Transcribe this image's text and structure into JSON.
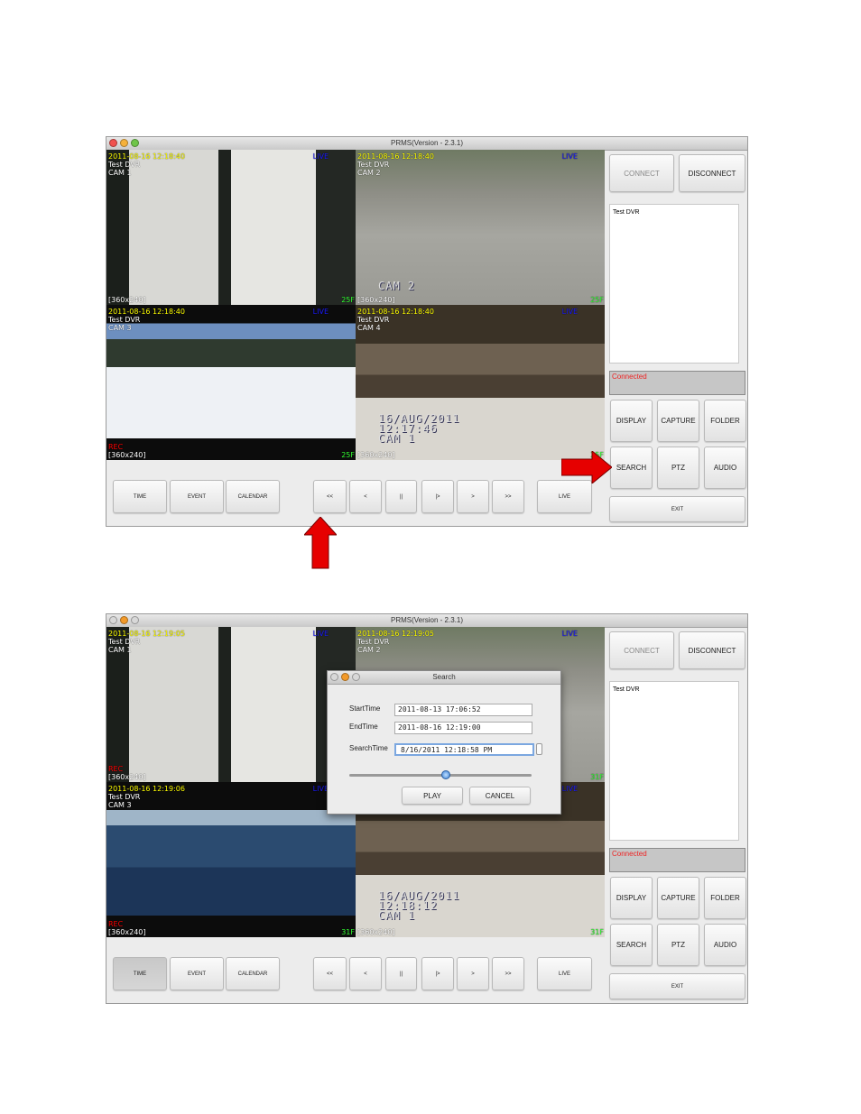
{
  "windows": [
    {
      "title": "PRMS(Version - 2.3.1)",
      "tiles": [
        {
          "timestamp": "2011-08-16 12:18:40",
          "dvr": "Test DVR",
          "cam": "CAM 1",
          "live": "LIVE",
          "rec": "",
          "resolution": "[360x240]",
          "fps": "25F",
          "scene": "door"
        },
        {
          "timestamp": "2011-08-16 12:18:40",
          "dvr": "Test DVR",
          "cam": "CAM 2",
          "live": "LIVE",
          "rec": "",
          "resolution": "[360x240]",
          "fps": "25F",
          "scene": "parking",
          "burned": "CAM 2"
        },
        {
          "timestamp": "2011-08-16 12:18:40",
          "dvr": "Test DVR",
          "cam": "CAM 3",
          "live": "LIVE",
          "rec": "REC",
          "resolution": "[360x240]",
          "fps": "25F",
          "scene": "snow"
        },
        {
          "timestamp": "2011-08-16 12:18:40",
          "dvr": "Test DVR",
          "cam": "CAM 4",
          "live": "LIVE",
          "rec": "",
          "resolution": "[360x240]",
          "fps": "25F",
          "scene": "warehouse",
          "burned": "16/AUG/2011\n12:17:46\nCAM 1"
        }
      ],
      "connect": "CONNECT",
      "disconnect": "DISCONNECT",
      "dvr_list": [
        "Test DVR"
      ],
      "status": "Connected",
      "panel_buttons": [
        "DISPLAY",
        "CAPTURE",
        "FOLDER",
        "SEARCH",
        "PTZ",
        "AUDIO"
      ],
      "exit": "EXIT",
      "bottom_buttons": [
        "TIME",
        "EVENT",
        "CALENDAR",
        "<<",
        "<",
        "||",
        "|>",
        ">",
        ">>",
        "LIVE"
      ],
      "pressed": ""
    },
    {
      "title": "PRMS(Version - 2.3.1)",
      "tiles": [
        {
          "timestamp": "2011-08-16 12:19:05",
          "dvr": "Test DVR",
          "cam": "CAM 1",
          "live": "LIVE",
          "rec": "REC",
          "resolution": "[360x240]",
          "fps": "",
          "scene": "door"
        },
        {
          "timestamp": "2011-08-16 12:19:05",
          "dvr": "Test DVR",
          "cam": "CAM 2",
          "live": "LIVE",
          "rec": "",
          "resolution": "",
          "fps": "31F",
          "scene": "parking"
        },
        {
          "timestamp": "2011-08-16 12:19:06",
          "dvr": "Test DVR",
          "cam": "CAM 3",
          "live": "LIVE",
          "rec": "REC",
          "resolution": "[360x240]",
          "fps": "31F",
          "scene": "wave"
        },
        {
          "timestamp": "",
          "dvr": "",
          "cam": "",
          "live": "LIVE",
          "rec": "",
          "resolution": "[360x240]",
          "fps": "31F",
          "scene": "warehouse",
          "burned": "16/AUG/2011\n12:18:12\nCAM 1"
        }
      ],
      "connect": "CONNECT",
      "disconnect": "DISCONNECT",
      "dvr_list": [
        "Test DVR"
      ],
      "status": "Connected",
      "panel_buttons": [
        "DISPLAY",
        "CAPTURE",
        "FOLDER",
        "SEARCH",
        "PTZ",
        "AUDIO"
      ],
      "exit": "EXIT",
      "bottom_buttons": [
        "TIME",
        "EVENT",
        "CALENDAR",
        "<<",
        "<",
        "||",
        "|>",
        ">",
        ">>",
        "LIVE"
      ],
      "pressed": "TIME",
      "search_dialog": {
        "title": "Search",
        "start_label": "StartTime",
        "start_value": "2011-08-13 17:06:52",
        "end_label": "EndTime",
        "end_value": "2011-08-16 12:19:00",
        "search_label": "SearchTime",
        "search_value": "8/16/2011 12:18:58 PM",
        "slider_position": 0.53,
        "play": "PLAY",
        "cancel": "CANCEL"
      }
    }
  ],
  "annotations": {
    "arrow_color": "#e60000",
    "arrows": [
      "arrow-right-to-search",
      "arrow-up-to-rewind"
    ]
  }
}
